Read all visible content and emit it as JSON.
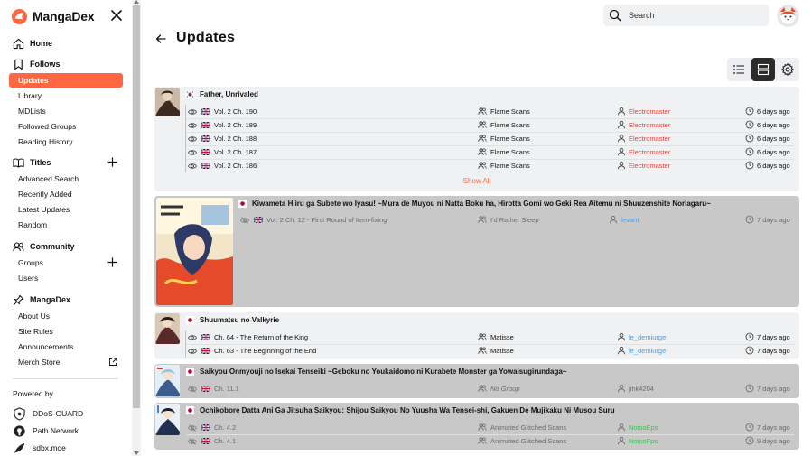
{
  "brand": {
    "name": "MangaDex"
  },
  "sidebar": {
    "home": "Home",
    "follows": "Follows",
    "follows_items": [
      "Updates",
      "Library",
      "MDLists",
      "Followed Groups",
      "Reading History"
    ],
    "titles": "Titles",
    "titles_items": [
      "Advanced Search",
      "Recently Added",
      "Latest Updates",
      "Random"
    ],
    "community": "Community",
    "community_items": [
      "Groups",
      "Users"
    ],
    "mangadex": "MangaDex",
    "mangadex_items": [
      "About Us",
      "Site Rules",
      "Announcements",
      "Merch Store"
    ],
    "powered_by": "Powered by",
    "partners": [
      "DDoS-GUARD",
      "Path Network",
      "sdbx.moe"
    ]
  },
  "header": {
    "search_placeholder": "Search"
  },
  "page": {
    "title": "Updates"
  },
  "colors": {
    "accent": "#ff6740",
    "group_user_red": "#e0463e",
    "user_blue": "#4aa0e6",
    "user_green": "#3fbf4f"
  },
  "feed": [
    {
      "flag": "kr",
      "title": "Father, Unrivaled",
      "rows": [
        {
          "chapter": "Vol. 2 Ch. 190",
          "group": "Flame Scans",
          "user": "Electromaster",
          "time": "6 days ago"
        },
        {
          "chapter": "Vol. 2 Ch. 189",
          "group": "Flame Scans",
          "user": "Electromaster",
          "time": "6 days ago"
        },
        {
          "chapter": "Vol. 2 Ch. 188",
          "group": "Flame Scans",
          "user": "Electromaster",
          "time": "6 days ago"
        },
        {
          "chapter": "Vol. 2 Ch. 187",
          "group": "Flame Scans",
          "user": "Electromaster",
          "time": "6 days ago"
        },
        {
          "chapter": "Vol. 2 Ch. 186",
          "group": "Flame Scans",
          "user": "Electromaster",
          "time": "6 days ago"
        }
      ],
      "show_all": "Show All"
    },
    {
      "flag": "jp",
      "title": "Kiwameta Hiiru ga Subete wo Iyasu! ~Mura de Muyou ni Natta Boku ha, Hirotta Gomi wo Geki Rea Aitemu ni Shuuzenshite Noriagaru~",
      "rows": [
        {
          "chapter": "Vol. 2 Ch. 12 - First Round of Item-fixing",
          "group": "I'd Rather Sleep",
          "user": "fevant",
          "time": "7 days ago"
        }
      ]
    },
    {
      "flag": "jp",
      "title": "Shuumatsu no Valkyrie",
      "rows": [
        {
          "chapter": "Ch. 64 - The Return of the King",
          "group": "Matisse",
          "user": "le_demiurge",
          "time": "7 days ago"
        },
        {
          "chapter": "Ch. 63 - The Beginning of the End",
          "group": "Matisse",
          "user": "le_demiurge",
          "time": "7 days ago"
        }
      ]
    },
    {
      "flag": "jp",
      "title": "Saikyou Onmyouji no Isekai Tenseiki ~Geboku no Youkaidomo ni Kurabete Monster ga Yowaisugirundaga~",
      "rows": [
        {
          "chapter": "Ch. 11.1",
          "group": "No Group",
          "user": "jihk4204",
          "time": "7 days ago"
        }
      ]
    },
    {
      "flag": "jp",
      "title": "Ochikobore Datta Ani Ga Jitsuha Saikyou: Shijou Saikyou No Yuusha Wa Tensei-shi, Gakuen De Mujikaku Ni Musou Suru",
      "rows": [
        {
          "chapter": "Ch. 4.2",
          "group": "Animated Glitched Scans",
          "user": "NotsoEps",
          "time": "7 days ago"
        },
        {
          "chapter": "Ch. 4.1",
          "group": "Animated Glitched Scans",
          "user": "NotsoFps",
          "time": "9 days ago"
        }
      ]
    }
  ]
}
